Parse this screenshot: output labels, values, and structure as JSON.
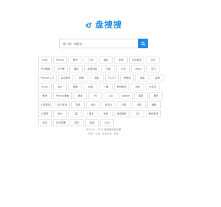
{
  "brand": {
    "name": "盘搜搜",
    "color": "#1e88e5"
  },
  "search": {
    "placeholder": "搜一搜，电影名..",
    "button_icon": "search-icon"
  },
  "tags": [
    "Java",
    "Python",
    "教资",
    "三体",
    "电影",
    "考研",
    "初中数学",
    "小说",
    "PPT模板",
    "乡宁教",
    "摄影",
    "英语四级",
    "日漫",
    "小说",
    "Word",
    "学习",
    "Python入门",
    "高中数学",
    "韩剧",
    "电影",
    "PS入门",
    "新概念",
    "电影",
    "高考",
    "Excel",
    "会计",
    "美剧",
    "动漫",
    "一建",
    "考研数学",
    "中医",
    "公务员",
    "教资",
    "Python基础",
    "健身",
    "PS",
    "CAD",
    "Adobe",
    "建筑",
    "雅思",
    "小学英语",
    "初中英语",
    "英语",
    "设计",
    "纪录片",
    "日语",
    "日剧",
    "编程",
    "心理学",
    "考公",
    "二建",
    "C语言",
    "法考",
    "综合教资",
    "3D",
    "考研英语",
    "刑法",
    "初中物理",
    "历史",
    "影视",
    "C4D"
  ],
  "footer": {
    "copyright": "@2019 - 2022 盘搜搜网站地图",
    "links": [
      "首页",
      "公告",
      "企业合作",
      "更多"
    ]
  }
}
